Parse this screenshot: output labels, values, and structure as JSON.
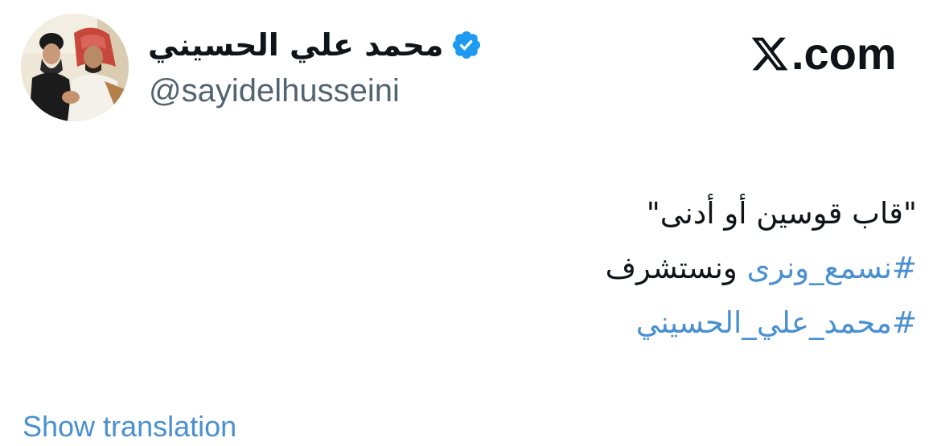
{
  "author": {
    "display_name": "محمد علي الحسيني",
    "handle": "@sayidelhusseini",
    "avatar_icon": "profile-photo",
    "verified_icon": "verified-badge-icon",
    "verified_color": "#1d9bf0"
  },
  "brand": {
    "logo_icon": "x-logo-icon",
    "suffix": ".com"
  },
  "tweet": {
    "line1": "\"قاب قوسين أو أدنى\"",
    "line2_hashtag": "#نسمع_ونرى",
    "line2_text": " ونستشرف",
    "line3_hashtag": "#محمد_علي_الحسيني"
  },
  "actions": {
    "show_translation": "Show translation"
  },
  "colors": {
    "text": "#0f1419",
    "secondary": "#536471",
    "link": "#4a90d0"
  }
}
